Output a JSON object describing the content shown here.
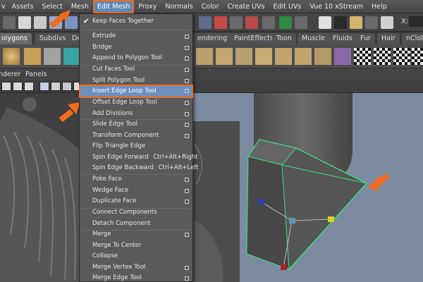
{
  "menubar": {
    "items": [
      "Assets",
      "Select",
      "Mesh",
      "Edit Mesh",
      "Proxy",
      "Normals",
      "Color",
      "Create UVs",
      "Edit UVs",
      "Vue 10 xStream",
      "Help"
    ],
    "active_index": 3,
    "first_partial": "v"
  },
  "statusline": {
    "x_label": "X:"
  },
  "shelf_tabs": [
    "olygons",
    "Subdivs",
    "Defo",
    "endering",
    "PaintEffects",
    "Toon",
    "Muscle",
    "Fluids",
    "Fur",
    "Hair",
    "nClot"
  ],
  "panel_menu": [
    "nderer",
    "Panels"
  ],
  "dropdown": {
    "items": [
      {
        "label": "Keep Faces Together",
        "checked": true
      },
      {
        "label": "Extrude",
        "option": true
      },
      {
        "label": "Bridge",
        "option": true
      },
      {
        "label": "Append to Polygon Tool",
        "option": true
      },
      {
        "label": "Cut Faces Tool",
        "option": true
      },
      {
        "label": "Split Polygon Tool",
        "option": true
      },
      {
        "label": "Insert Edge Loop Tool",
        "option": true,
        "highlighted": true
      },
      {
        "label": "Offset Edge Loop Tool",
        "option": true
      },
      {
        "label": "Add Divisions",
        "option": true
      },
      {
        "label": "Slide Edge Tool",
        "option": true
      },
      {
        "label": "Transform Component",
        "option": true
      },
      {
        "label": "Flip Triangle Edge"
      },
      {
        "label": "Spin Edge Forward",
        "shortcut": "Ctrl+Alt+Right"
      },
      {
        "label": "Spin Edge Backward",
        "shortcut": "Ctrl+Alt+Left"
      },
      {
        "label": "Poke Face",
        "option": true
      },
      {
        "label": "Wedge Face",
        "option": true
      },
      {
        "label": "Duplicate Face",
        "option": true
      },
      {
        "label": "Connect Components"
      },
      {
        "label": "Detach Component"
      },
      {
        "label": "Merge",
        "option": true
      },
      {
        "label": "Merge To Center"
      },
      {
        "label": "Collapse"
      },
      {
        "label": "Merge Vertex Tool",
        "option": true
      },
      {
        "label": "Merge Edge Tool",
        "option": true
      }
    ]
  },
  "colors": {
    "menu_bg": "#5a5a5a",
    "highlight": "#6d8fbd",
    "annotation_orange": "#f26b1d",
    "selection_green": "#3ddc84"
  }
}
